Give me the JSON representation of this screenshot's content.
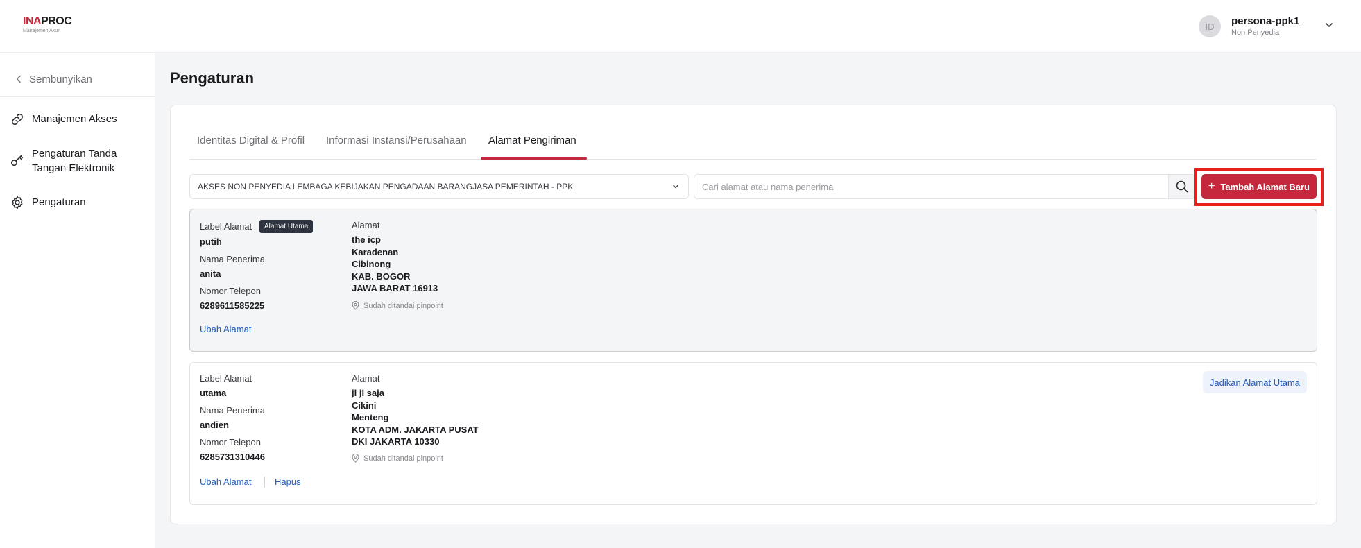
{
  "header": {
    "logo_main_red": "INA",
    "logo_main_dark": "PROC",
    "logo_sub": "Manajemen Akun",
    "avatar_initials": "ID",
    "user_name": "persona-ppk1",
    "user_role": "Non Penyedia"
  },
  "sidebar": {
    "hide_label": "Sembunyikan",
    "items": [
      {
        "label": "Manajemen Akses",
        "icon": "link-icon"
      },
      {
        "label": "Pengaturan Tanda Tangan Elektronik",
        "icon": "key-icon"
      },
      {
        "label": "Pengaturan",
        "icon": "gear-icon"
      }
    ]
  },
  "page": {
    "title": "Pengaturan"
  },
  "tabs": [
    {
      "label": "Identitas Digital & Profil",
      "active": false
    },
    {
      "label": "Informasi Instansi/Perusahaan",
      "active": false
    },
    {
      "label": "Alamat Pengiriman",
      "active": true
    }
  ],
  "filter": {
    "selected_access": "AKSES NON PENYEDIA LEMBAGA KEBIJAKAN PENGADAAN BARANGJASA PEMERINTAH - PPK",
    "search_placeholder": "Cari alamat atau nama penerima",
    "search_value": "",
    "add_button_label": "Tambah Alamat Baru"
  },
  "field_labels": {
    "label_alamat": "Label Alamat",
    "nama_penerima": "Nama Penerima",
    "nomor_telepon": "Nomor Telepon",
    "alamat": "Alamat"
  },
  "addresses": [
    {
      "label": "putih",
      "badge": "Alamat Utama",
      "recipient": "anita",
      "phone": "6289611585225",
      "lines": [
        "the icp",
        "Karadenan",
        "Cibinong",
        "KAB. BOGOR",
        "JAWA BARAT 16913"
      ],
      "pinpoint": "Sudah ditandai pinpoint",
      "edit_label": "Ubah Alamat"
    },
    {
      "label": "utama",
      "recipient": "andien",
      "phone": "6285731310446",
      "lines": [
        "jl jl saja",
        "Cikini",
        "Menteng",
        "KOTA ADM. JAKARTA PUSAT",
        "DKI JAKARTA 10330"
      ],
      "pinpoint": "Sudah ditandai pinpoint",
      "edit_label": "Ubah Alamat",
      "delete_label": "Hapus",
      "make_primary_label": "Jadikan Alamat Utama"
    }
  ],
  "colors": {
    "brand_red": "#c5283d",
    "link_blue": "#1f5bbf",
    "highlight_red": "#e5231b",
    "badge_dark": "#2d3440"
  }
}
